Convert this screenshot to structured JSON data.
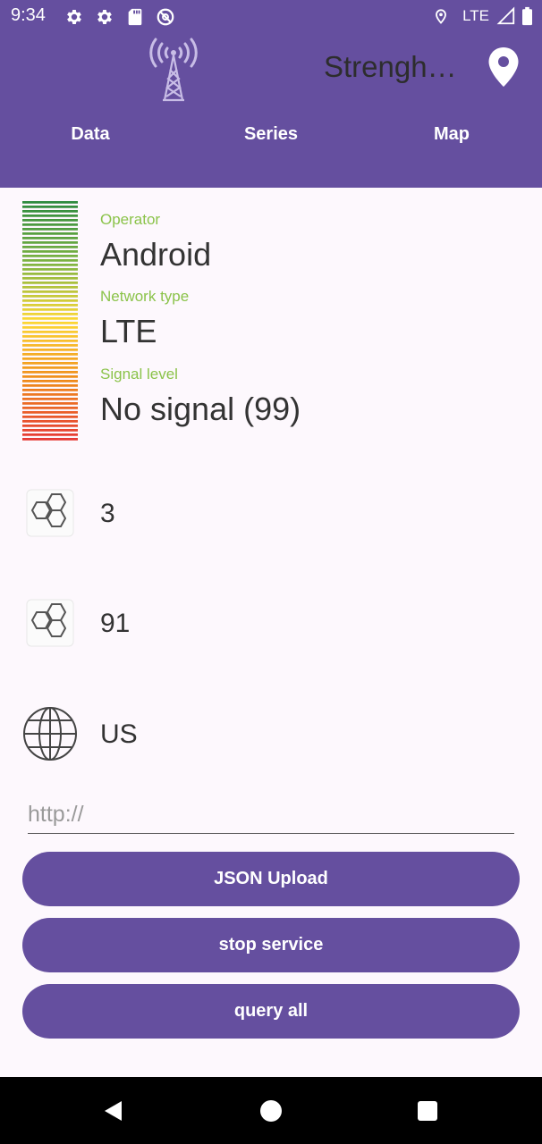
{
  "status_bar": {
    "time": "9:34",
    "network": "LTE",
    "icons_left": [
      "settings-icon",
      "settings-icon",
      "sd-card-icon",
      "at-sign-icon"
    ],
    "icons_right": [
      "location-icon",
      "signal-icon",
      "battery-icon"
    ]
  },
  "header": {
    "title": "Strengh…",
    "logo_icon": "radio-tower-icon",
    "action_icon": "map-pin-icon"
  },
  "tabs": [
    {
      "label": "Data"
    },
    {
      "label": "Series"
    },
    {
      "label": "Map"
    }
  ],
  "signal_info": {
    "operator_label": "Operator",
    "operator_value": "Android",
    "network_type_label": "Network type",
    "network_type_value": "LTE",
    "signal_level_label": "Signal level",
    "signal_level_value": "No signal (99)"
  },
  "rows": [
    {
      "icon": "cells-icon",
      "value": "3"
    },
    {
      "icon": "cells-icon",
      "value": "91"
    },
    {
      "icon": "globe-icon",
      "value": "US"
    }
  ],
  "url_field": {
    "placeholder": "http://",
    "value": ""
  },
  "buttons": {
    "json_upload": "JSON Upload",
    "stop_service": "stop service",
    "query_all": "query all"
  },
  "colors": {
    "primary": "#654f9f",
    "label_green": "#8bc34a",
    "signal_gradient": [
      "#2e8b3e",
      "#7cb342",
      "#fdd835",
      "#ef8c1a",
      "#e53935"
    ]
  },
  "nav": [
    "back-icon",
    "home-icon",
    "recents-icon"
  ]
}
